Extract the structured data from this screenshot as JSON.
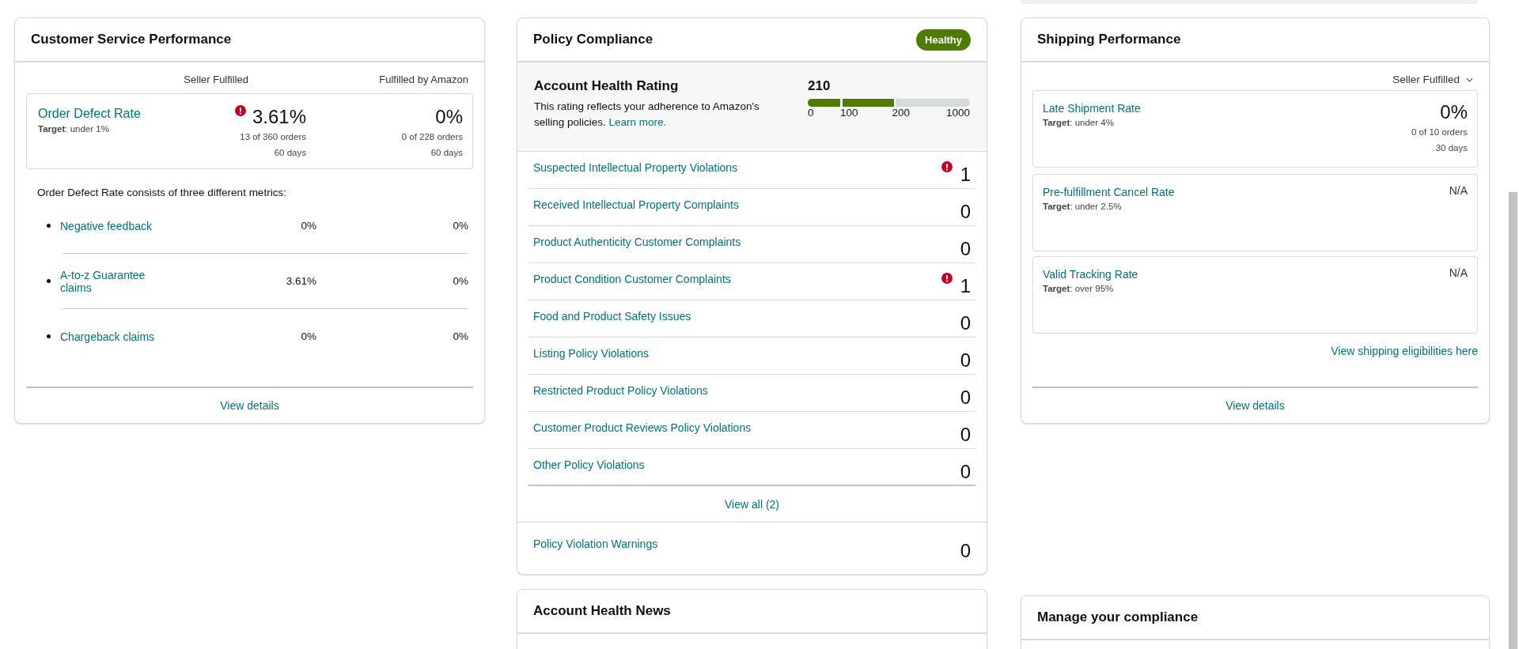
{
  "customer_service": {
    "title": "Customer Service Performance",
    "columns": [
      "Seller Fulfilled",
      "Fulfilled by Amazon"
    ],
    "odr": {
      "name": "Order Defect Rate",
      "target": "**Target**: under 1%",
      "values": [
        {
          "value": "3.61%",
          "orders": "13 of 360 orders",
          "period": "60 days",
          "alert": true
        },
        {
          "value": "0%",
          "orders": "0 of 228 orders",
          "period": "60 days",
          "alert": false
        }
      ]
    },
    "intro": "Order Defect Rate consists of three different metrics:",
    "metrics": [
      {
        "name": "Negative feedback",
        "values": [
          "0%",
          "0%"
        ]
      },
      {
        "name": "A-to-z Guarantee claims",
        "values": [
          "3.61%",
          "0%"
        ]
      },
      {
        "name": "Chargeback claims",
        "values": [
          "0%",
          "0%"
        ]
      }
    ],
    "footer_link": "View details"
  },
  "policy": {
    "title": "Policy Compliance",
    "status": "Healthy",
    "rating": {
      "title": "Account Health Rating",
      "description": "This rating reflects your adherence to Amazon's selling policies.",
      "link": "Learn more.",
      "score": "210",
      "level": 0.54,
      "ticks": [
        "0",
        "100",
        "200",
        "1000"
      ]
    },
    "items": [
      {
        "name": "Suspected Intellectual Property Violations",
        "count": "1",
        "alert": true
      },
      {
        "name": "Received Intellectual Property Complaints",
        "count": "0",
        "alert": false
      },
      {
        "name": "Product Authenticity Customer Complaints",
        "count": "0",
        "alert": false
      },
      {
        "name": "Product Condition Customer Complaints",
        "count": "1",
        "alert": true
      },
      {
        "name": "Food and Product Safety Issues",
        "count": "0",
        "alert": false
      },
      {
        "name": "Listing Policy Violations",
        "count": "0",
        "alert": false
      },
      {
        "name": "Restricted Product Policy Violations",
        "count": "0",
        "alert": false
      },
      {
        "name": "Customer Product Reviews Policy Violations",
        "count": "0",
        "alert": false
      },
      {
        "name": "Other Policy Violations",
        "count": "0",
        "alert": false
      }
    ],
    "view_all": "View all (2)",
    "warnings": {
      "name": "Policy Violation Warnings",
      "count": "0"
    }
  },
  "shipping": {
    "title": "Shipping Performance",
    "filter": "Seller Fulfilled",
    "metrics": [
      {
        "name": "Late Shipment Rate",
        "target": "**Target**: under 4%",
        "value": "0%",
        "orders": "0 of 10 orders",
        "period": "30 days"
      },
      {
        "name": "Pre-fulfillment Cancel Rate",
        "target": "**Target**: under 2.5%",
        "value": "N/A"
      },
      {
        "name": "Valid Tracking Rate",
        "target": "**Target**: over 95%",
        "value": "N/A"
      }
    ],
    "link": "View shipping eligibilities here",
    "footer_link": "View details"
  },
  "news": {
    "title": "Account Health News"
  },
  "compliance": {
    "title": "Manage your compliance"
  }
}
